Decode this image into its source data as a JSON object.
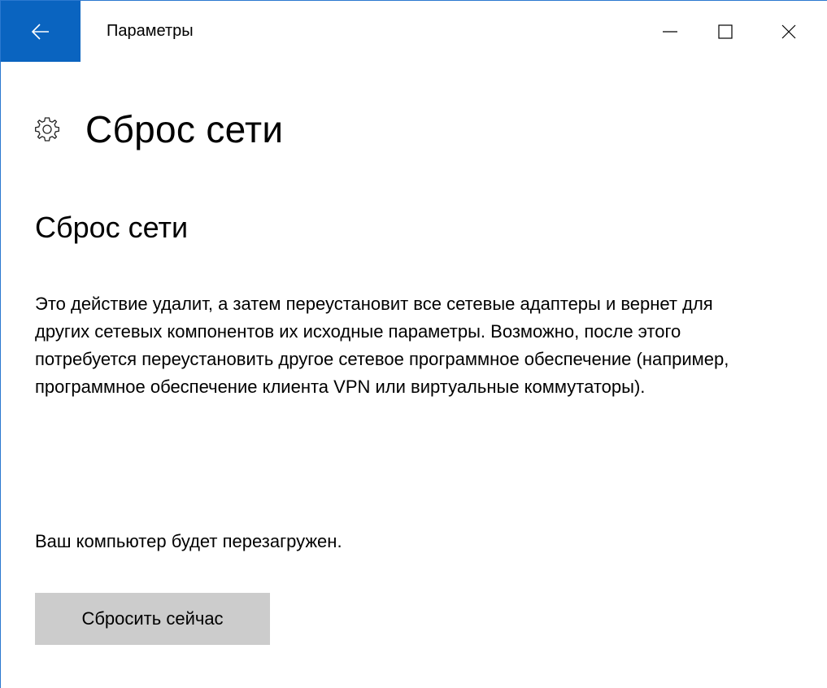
{
  "window": {
    "title": "Параметры",
    "accent": "#0a64c0",
    "border": "#2b79d0"
  },
  "titlebar": {
    "back_icon": "back-arrow-icon",
    "minimize_icon": "minimize-icon",
    "maximize_icon": "maximize-icon",
    "close_icon": "close-icon"
  },
  "header": {
    "icon": "gear-icon",
    "title": "Сброс сети"
  },
  "section": {
    "title": "Сброс сети",
    "description": "Это действие удалит, а затем переустановит все сетевые адаптеры и вернет для других сетевых компонентов их исходные параметры. Возможно, после этого потребуется переустановить другое сетевое программное обеспечение (например, программное обеспечение клиента VPN или виртуальные коммутаторы).",
    "note": "Ваш компьютер будет перезагружен."
  },
  "actions": {
    "reset_label": "Сбросить сейчас",
    "button_color": "#cccccc"
  }
}
